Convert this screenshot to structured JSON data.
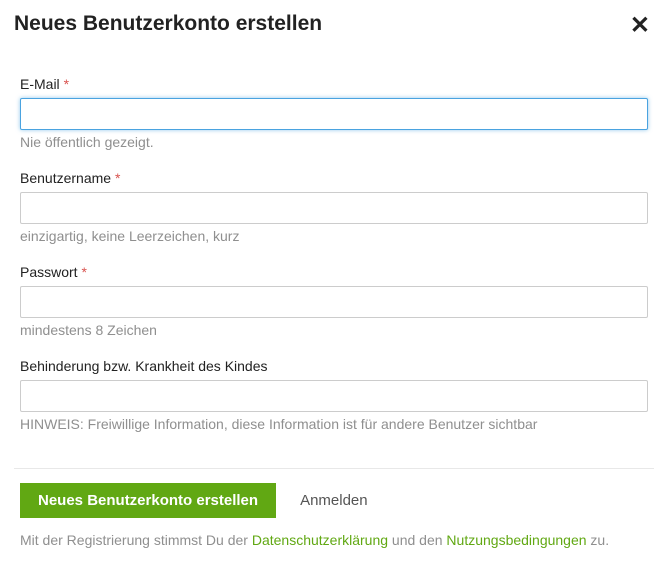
{
  "modal": {
    "title": "Neues Benutzerkonto erstellen"
  },
  "fields": {
    "email": {
      "label": "E-Mail ",
      "required": "*",
      "helper": "Nie öffentlich gezeigt.",
      "value": ""
    },
    "username": {
      "label": "Benutzername ",
      "required": "*",
      "helper": "einzigartig, keine Leerzeichen, kurz",
      "value": ""
    },
    "password": {
      "label": "Passwort ",
      "required": "*",
      "helper": "mindestens 8 Zeichen",
      "value": ""
    },
    "disability": {
      "label": "Behinderung bzw. Krankheit des Kindes",
      "helper": "HINWEIS: Freiwillige Information, diese Information ist für andere Benutzer sichtbar",
      "value": ""
    }
  },
  "actions": {
    "create": "Neues Benutzerkonto erstellen",
    "login": "Anmelden"
  },
  "consent": {
    "part1": "Mit der Registrierung stimmst Du der ",
    "privacy": "Datenschutzerklärung",
    "part2": " und den ",
    "terms": "Nutzungsbedingungen",
    "part3": " zu."
  }
}
